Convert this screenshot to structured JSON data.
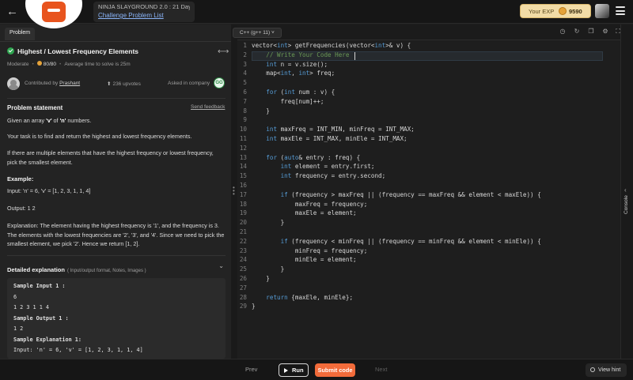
{
  "topbar": {
    "crumb_title": "NINJA SLAYGROUND 2.0 : 21 Day Co...",
    "crumb_link": "Challenge Problem List",
    "exp_label": "Your EXP",
    "exp_value": "9590"
  },
  "left": {
    "tab_label": "Problem",
    "title": "Highest / Lowest Frequency Elements",
    "difficulty": "Moderate",
    "score": "80/80",
    "avg_time": "Average time to solve is 25m",
    "contributed_by": "Contributed by",
    "contributor": "Prashant",
    "upvotes": "236 upvotes",
    "asked_in": "Asked in company",
    "company_logo_text": "GG",
    "statement_heading": "Problem statement",
    "send_feedback": "Send feedback",
    "p1_a": "Given an array ",
    "p1_v": "'v'",
    "p1_b": " of ",
    "p1_n": "'n'",
    "p1_c": " numbers.",
    "p2": "Your task is to find and return the highest and lowest frequency elements.",
    "p3": "If there are multiple elements that have the highest frequency or lowest frequency, pick the smallest element.",
    "example_heading": "Example:",
    "example_input": "Input: 'n' = 6, 'v' = [1, 2, 3, 1, 1, 4]",
    "example_output": "Output: 1 2",
    "explanation": "Explanation: The element having the highest frequency is '1', and the frequency is 3. The elements with the lowest frequencies are '2', '3', and '4'. Since we need to pick the smallest element, we pick '2'. Hence we return [1, 2].",
    "detail_title": "Detailed explanation",
    "detail_sub": "( Input/output format, Notes, Images )",
    "samples": [
      "Sample Input 1 :",
      "6",
      "1 2 3 1 1 4",
      "Sample Output 1 :",
      "1 2",
      "Sample Explanation 1:",
      "Input: 'n' = 6, 'v' = [1, 2, 3, 1, 1, 4]"
    ]
  },
  "editor": {
    "language": "C++ (g++ 11)",
    "lines": [
      "vector<int> getFrequencies(vector<int>& v) {",
      "    // Write Your Code Here",
      "    int n = v.size();",
      "    map<int, int> freq;",
      "",
      "    for (int num : v) {",
      "        freq[num]++;",
      "    }",
      "",
      "    int maxFreq = INT_MIN, minFreq = INT_MAX;",
      "    int maxEle = INT_MAX, minEle = INT_MAX;",
      "",
      "    for (auto& entry : freq) {",
      "        int element = entry.first;",
      "        int frequency = entry.second;",
      "",
      "        if (frequency > maxFreq || (frequency == maxFreq && element < maxEle)) {",
      "            maxFreq = frequency;",
      "            maxEle = element;",
      "        }",
      "",
      "        if (frequency < minFreq || (frequency == minFreq && element < minEle)) {",
      "            minFreq = frequency;",
      "            minEle = element;",
      "        }",
      "    }",
      "",
      "    return {maxEle, minEle};",
      "}"
    ]
  },
  "console_label": "Console",
  "bottom": {
    "prev": "Prev",
    "run": "Run",
    "submit": "Submit code",
    "next": "Next",
    "hint": "View hint"
  },
  "icons": [
    "back-arrow-icon",
    "menu-icon",
    "share-icon",
    "check-icon",
    "upvote-icon",
    "chevron-down-icon",
    "timer-icon",
    "refresh-icon",
    "copy-icon",
    "settings-icon",
    "fullscreen-icon",
    "play-icon",
    "bulb-icon"
  ],
  "colors": {
    "accent": "#f26b3a",
    "link": "#8ab4f8",
    "success": "#2ea44f",
    "exp_bg": "#f2dca6"
  }
}
